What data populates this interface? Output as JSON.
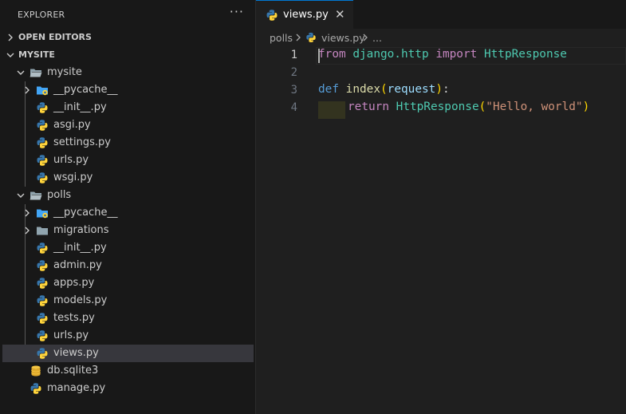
{
  "sidebar": {
    "title": "EXPLORER",
    "more": "···",
    "sections": {
      "open_editors": "OPEN EDITORS",
      "project": "MYSITE"
    },
    "tree": [
      {
        "name": "mysite",
        "type": "folder",
        "expanded": true,
        "depth": 0
      },
      {
        "name": "__pycache__",
        "type": "pycache",
        "expanded": false,
        "depth": 1
      },
      {
        "name": "__init__.py",
        "type": "python",
        "depth": 1
      },
      {
        "name": "asgi.py",
        "type": "python",
        "depth": 1
      },
      {
        "name": "settings.py",
        "type": "python",
        "depth": 1
      },
      {
        "name": "urls.py",
        "type": "python",
        "depth": 1
      },
      {
        "name": "wsgi.py",
        "type": "python",
        "depth": 1
      },
      {
        "name": "polls",
        "type": "folder",
        "expanded": true,
        "depth": 0
      },
      {
        "name": "__pycache__",
        "type": "pycache",
        "expanded": false,
        "depth": 1
      },
      {
        "name": "migrations",
        "type": "folder",
        "expanded": false,
        "depth": 1
      },
      {
        "name": "__init__.py",
        "type": "python",
        "depth": 1
      },
      {
        "name": "admin.py",
        "type": "python",
        "depth": 1
      },
      {
        "name": "apps.py",
        "type": "python",
        "depth": 1
      },
      {
        "name": "models.py",
        "type": "python",
        "depth": 1
      },
      {
        "name": "tests.py",
        "type": "python",
        "depth": 1
      },
      {
        "name": "urls.py",
        "type": "python",
        "depth": 1
      },
      {
        "name": "views.py",
        "type": "python",
        "depth": 1,
        "selected": true
      },
      {
        "name": "db.sqlite3",
        "type": "database",
        "depth": 0
      },
      {
        "name": "manage.py",
        "type": "python",
        "depth": 0
      }
    ]
  },
  "tab": {
    "label": "views.py",
    "close": "✕"
  },
  "breadcrumb": {
    "folder": "polls",
    "file": "views.py",
    "more": "..."
  },
  "editor": {
    "line_numbers": [
      "1",
      "2",
      "3",
      "4"
    ],
    "line1": {
      "kw_from": "from",
      "module": "django.http",
      "kw_import": "import",
      "cls": "HttpResponse"
    },
    "line3": {
      "kw_def": "def",
      "fn": "index",
      "open": "(",
      "param": "request",
      "close": ")",
      "colon": ":"
    },
    "line4": {
      "kw_return": "return",
      "cls": "HttpResponse",
      "open": "(",
      "str": "\"Hello, world\"",
      "close": ")"
    }
  },
  "colors": {
    "accent": "#0078d4",
    "python_blue": "#3776ab",
    "python_yellow": "#ffd43b",
    "folder": "#90a4ae",
    "pycache": "#42a5f5",
    "database": "#f4c542"
  }
}
